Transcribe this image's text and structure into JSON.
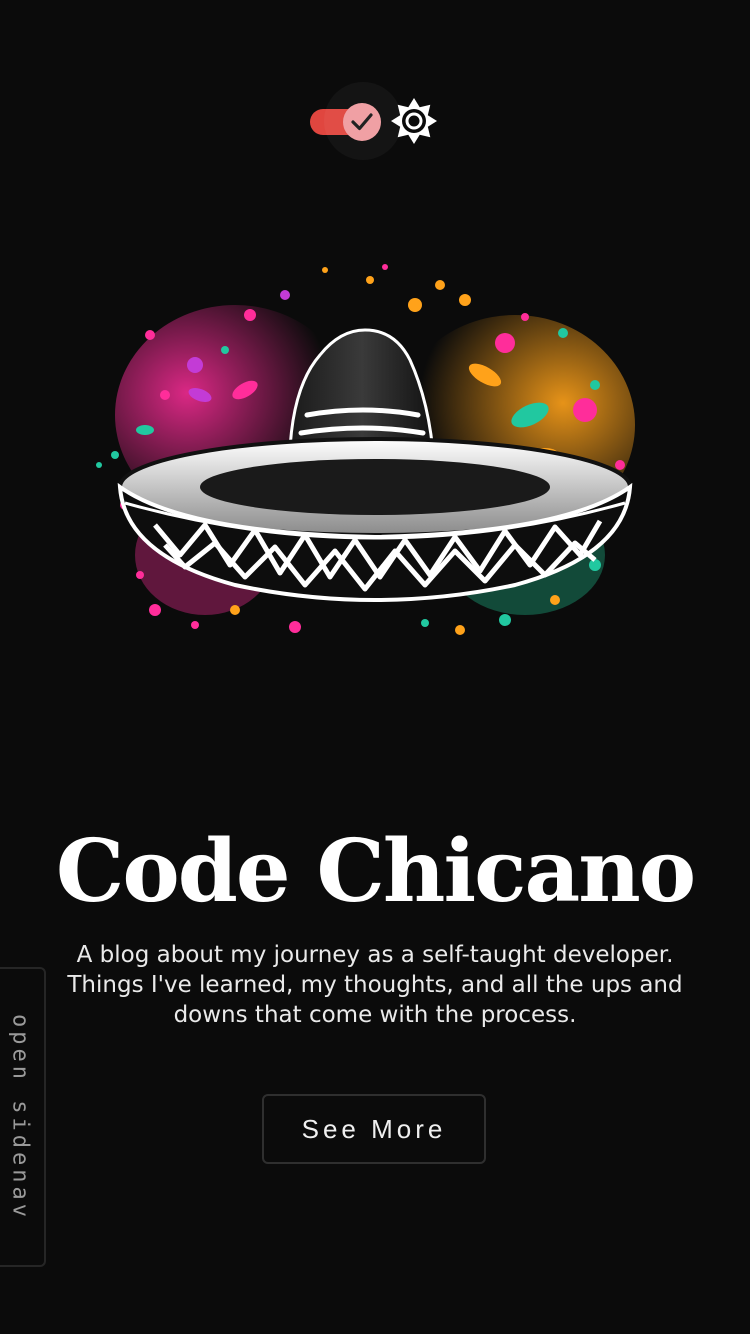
{
  "theme_toggle": {
    "state": "checked",
    "track_color": "#e0463f",
    "thumb_color": "#f0a0a4",
    "thumb_icon": "checkmark-icon",
    "mode_icon": "sun-icon"
  },
  "hero": {
    "logo_icon": "sombrero-logo",
    "title": "Code Chicano",
    "subtitle": "A blog about my journey as a self-taught developer. Things I've learned, my thoughts, and all the ups and downs that come with the process.",
    "cta_label": "See More"
  },
  "sidenav": {
    "toggle_label": "open sidenav"
  },
  "colors": {
    "background": "#0b0b0b",
    "text": "#ffffff",
    "accent": "#e0463f"
  }
}
